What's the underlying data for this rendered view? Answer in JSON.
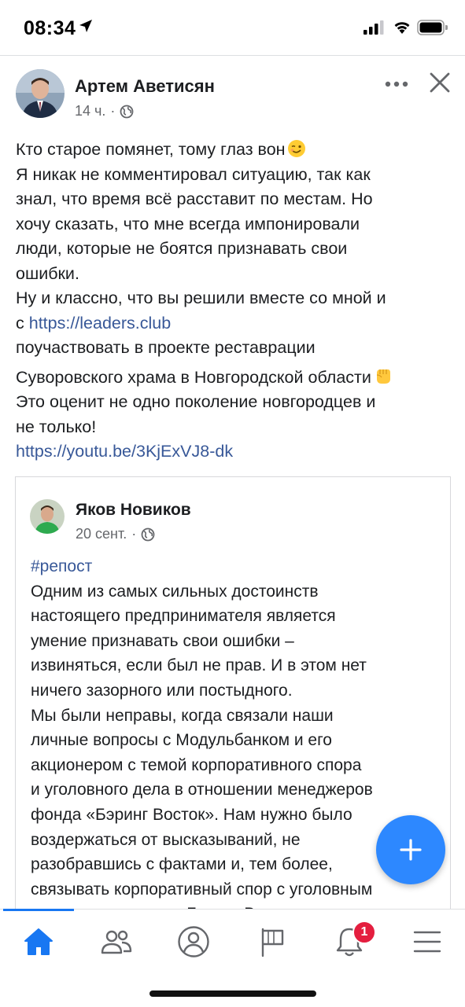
{
  "status_bar": {
    "time": "08:34"
  },
  "post": {
    "author": "Артем Аветисян",
    "time": "14 ч.",
    "meta_separator": "·",
    "lines": [
      {
        "text": "Кто старое помянет, тому глаз вон",
        "emoji": "winking-face"
      },
      {
        "text": "Я никак не комментировал ситуацию, так как"
      },
      {
        "text": "знал, что время всё расставит по местам. Но"
      },
      {
        "text": "хочу сказать, что  мне всегда импонировали"
      },
      {
        "text": "люди, которые не боятся признавать свои"
      },
      {
        "text": "ошибки."
      },
      {
        "text": "Ну и классно, что вы решили вместе со мной и"
      },
      {
        "prefix": "с ",
        "link": "https://leaders.club"
      },
      {
        "text": "поучаствовать в проекте реставрации"
      },
      {
        "text": "Суворовского храма в Новгородской области",
        "emoji": "raised-fist"
      },
      {
        "text": "Это оценит не одно поколение новгородцев и"
      },
      {
        "text": "не только!"
      },
      {
        "link": "https://youtu.be/3KjExVJ8-dk"
      }
    ]
  },
  "shared_post": {
    "author": "Яков Новиков",
    "time": "20 сент.",
    "meta_separator": "·",
    "hashtag": "#репост",
    "lines": [
      "Одним из самых сильных достоинств",
      "настоящего предпринимателя является",
      "умение признавать свои ошибки –",
      "извиняться, если был не прав. И в этом нет",
      "ничего зазорного или постыдного.",
      "Мы были неправы, когда связали наши",
      "личные вопросы с Модульбанком и его",
      "акционером с темой корпоративного спора",
      "и уголовного дела в отношении менеджеров",
      "фонда «Бэринг Восток». Нам нужно было",
      "воздержаться от высказываний, не",
      "разобравшись с фактами и, тем более,",
      "связывать корпоративный спор с уголовным",
      "делом в отношении Бэринг Восток"
    ]
  },
  "tab_bar": {
    "tabs": [
      "home-icon",
      "friends-icon",
      "profile-icon",
      "pages-icon",
      "notifications-icon",
      "menu-icon"
    ],
    "notification_count": "1"
  },
  "colors": {
    "link": "#385898",
    "accent": "#1877f2",
    "fab": "#2d88ff",
    "badge": "#e41e3f"
  }
}
